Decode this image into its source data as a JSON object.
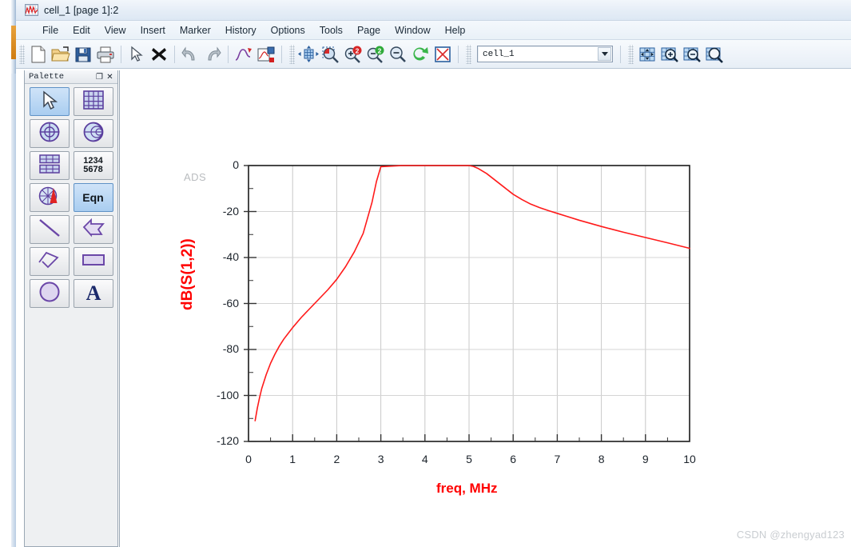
{
  "window": {
    "title": "cell_1 [page 1]:2",
    "title_icon": "plot-window-icon"
  },
  "menubar": {
    "items": [
      {
        "label": "File"
      },
      {
        "label": "Edit"
      },
      {
        "label": "View"
      },
      {
        "label": "Insert"
      },
      {
        "label": "Marker"
      },
      {
        "label": "History"
      },
      {
        "label": "Options"
      },
      {
        "label": "Tools"
      },
      {
        "label": "Page"
      },
      {
        "label": "Window"
      },
      {
        "label": "Help"
      }
    ]
  },
  "toolbar": {
    "buttons": [
      {
        "name": "new-file-icon"
      },
      {
        "name": "open-folder-icon"
      },
      {
        "name": "save-icon"
      },
      {
        "name": "print-icon"
      },
      {
        "name": "select-arrow-icon"
      },
      {
        "name": "delete-x-icon"
      },
      {
        "name": "undo-icon"
      },
      {
        "name": "redo-icon"
      },
      {
        "name": "curve-tool-icon"
      },
      {
        "name": "insert-plot-icon"
      },
      {
        "name": "pan-icon"
      },
      {
        "name": "zoom-area-icon"
      },
      {
        "name": "zoom-in-2x-icon"
      },
      {
        "name": "zoom-out-2x-icon"
      },
      {
        "name": "zoom-out-icon"
      },
      {
        "name": "refresh-icon"
      },
      {
        "name": "stop-icon"
      },
      {
        "name": "fit-page-icon"
      },
      {
        "name": "page-zoom-in-icon"
      },
      {
        "name": "page-zoom-out-icon"
      },
      {
        "name": "page-zoom-area-icon"
      }
    ],
    "combo": {
      "value": "cell_1",
      "arrow_icon": "chevron-down-icon"
    }
  },
  "palette": {
    "title": "Palette",
    "float_btn": "❐",
    "close_btn": "✕",
    "items": [
      {
        "name": "pointer-tool",
        "icon": "arrow-cursor-icon",
        "selected": true,
        "text": ""
      },
      {
        "name": "rect-plot-tool",
        "icon": "rectangular-plot-icon",
        "selected": false,
        "text": ""
      },
      {
        "name": "polar-plot-tool",
        "icon": "polar-plot-icon",
        "selected": false,
        "text": ""
      },
      {
        "name": "smith-chart-tool",
        "icon": "smith-chart-icon",
        "selected": false,
        "text": ""
      },
      {
        "name": "stacked-plot-tool",
        "icon": "stacked-rect-plot-icon",
        "selected": false,
        "text": ""
      },
      {
        "name": "list-table-tool",
        "icon": "numeric-list-icon",
        "selected": false,
        "text": "1234\n5678"
      },
      {
        "name": "antenna-plot-tool",
        "icon": "antenna-pattern-icon",
        "selected": false,
        "text": ""
      },
      {
        "name": "equation-tool",
        "icon": "equation-icon",
        "selected": false,
        "text": "Eqn"
      },
      {
        "name": "line-tool",
        "icon": "line-icon",
        "selected": false,
        "text": ""
      },
      {
        "name": "polygon-tool",
        "icon": "polygon-icon",
        "selected": false,
        "text": ""
      },
      {
        "name": "polyline-tool",
        "icon": "polyline-icon",
        "selected": false,
        "text": ""
      },
      {
        "name": "rectangle-tool",
        "icon": "rectangle-icon",
        "selected": false,
        "text": ""
      },
      {
        "name": "circle-tool",
        "icon": "circle-icon",
        "selected": false,
        "text": ""
      },
      {
        "name": "text-tool",
        "icon": "text-letter-a-icon",
        "selected": false,
        "text": "A"
      }
    ]
  },
  "plot": {
    "ads_watermark": "ADS",
    "csdn_watermark": "CSDN @zhengyad123"
  },
  "chart_data": {
    "type": "line",
    "title": "",
    "xlabel": "freq, MHz",
    "ylabel": "dB(S(1,2))",
    "xlim": [
      0,
      10
    ],
    "ylim": [
      -120,
      0
    ],
    "xticks": [
      "0",
      "1",
      "2",
      "3",
      "4",
      "5",
      "6",
      "7",
      "8",
      "9",
      "10"
    ],
    "yticks": [
      "0",
      "-20",
      "-40",
      "-60",
      "-80",
      "-100",
      "-120"
    ],
    "xminor_per_major": 2,
    "yminor_per_major": 2,
    "grid": true,
    "legend": "none",
    "series": [
      {
        "name": "dB(S(1,2))",
        "color": "#ff1a1a",
        "x": [
          0.15,
          0.2,
          0.25,
          0.3,
          0.35,
          0.4,
          0.5,
          0.6,
          0.7,
          0.8,
          0.9,
          1.0,
          1.2,
          1.4,
          1.6,
          1.8,
          2.0,
          2.2,
          2.4,
          2.6,
          2.8,
          2.9,
          3.0,
          3.5,
          4.0,
          4.5,
          5.0,
          5.1,
          5.2,
          5.4,
          5.6,
          5.8,
          6.0,
          6.2,
          6.4,
          6.6,
          6.8,
          7.0,
          7.2,
          7.5,
          8.0,
          8.5,
          9.0,
          9.5,
          10.0
        ],
        "y": [
          -111.0,
          -105.5,
          -101.0,
          -97.0,
          -94.0,
          -91.0,
          -86.0,
          -82.0,
          -78.5,
          -75.5,
          -73.0,
          -70.5,
          -66.0,
          -62.0,
          -58.0,
          -54.0,
          -49.5,
          -44.0,
          -37.5,
          -29.5,
          -16.0,
          -7.0,
          -0.5,
          0.0,
          0.0,
          0.0,
          0.0,
          -0.4,
          -1.2,
          -3.5,
          -6.5,
          -9.5,
          -12.5,
          -14.8,
          -16.8,
          -18.3,
          -19.6,
          -20.8,
          -22.0,
          -23.8,
          -26.5,
          -29.0,
          -31.3,
          -33.6,
          -36.0
        ]
      }
    ]
  }
}
